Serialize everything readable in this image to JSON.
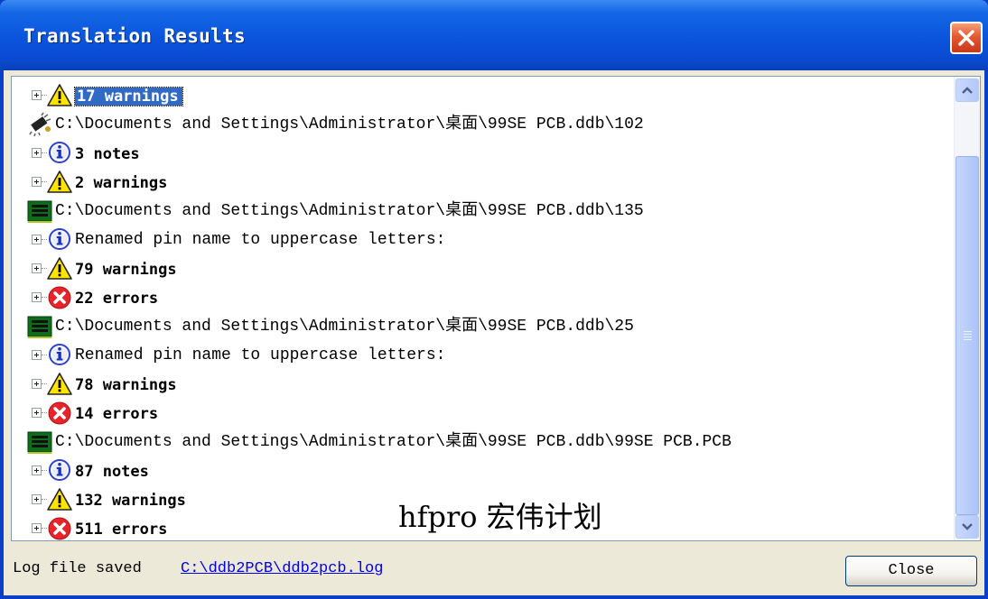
{
  "window": {
    "title": "Translation Results"
  },
  "tree": [
    {
      "kind": "warning",
      "text": "17 warnings",
      "bold": true,
      "selected": true,
      "indent": 1
    },
    {
      "kind": "component",
      "text": "C:\\Documents and Settings\\Administrator\\桌面\\99SE PCB.ddb\\102",
      "indent": 0
    },
    {
      "kind": "note",
      "text": "3 notes",
      "bold": true,
      "indent": 1
    },
    {
      "kind": "warning",
      "text": "2 warnings",
      "bold": true,
      "indent": 1
    },
    {
      "kind": "pcb",
      "text": "C:\\Documents and Settings\\Administrator\\桌面\\99SE PCB.ddb\\135",
      "indent": 0
    },
    {
      "kind": "note",
      "text": "Renamed pin name to uppercase letters:",
      "indent": 1
    },
    {
      "kind": "warning",
      "text": "79 warnings",
      "bold": true,
      "indent": 1
    },
    {
      "kind": "error",
      "text": "22 errors",
      "bold": true,
      "indent": 1
    },
    {
      "kind": "pcb",
      "text": "C:\\Documents and Settings\\Administrator\\桌面\\99SE PCB.ddb\\25",
      "indent": 0
    },
    {
      "kind": "note",
      "text": "Renamed pin name to uppercase letters:",
      "indent": 1
    },
    {
      "kind": "warning",
      "text": "78 warnings",
      "bold": true,
      "indent": 1
    },
    {
      "kind": "error",
      "text": "14 errors",
      "bold": true,
      "indent": 1
    },
    {
      "kind": "pcb",
      "text": "C:\\Documents and Settings\\Administrator\\桌面\\99SE PCB.ddb\\99SE PCB.PCB",
      "indent": 0
    },
    {
      "kind": "note",
      "text": "87 notes",
      "bold": true,
      "indent": 1
    },
    {
      "kind": "warning",
      "text": "132 warnings",
      "bold": true,
      "indent": 1
    },
    {
      "kind": "error",
      "text": "511 errors",
      "bold": true,
      "indent": 1
    }
  ],
  "watermark": "hfpro 宏伟计划",
  "footer": {
    "label": "Log file saved",
    "link": "C:\\ddb2PCB\\ddb2pcb.log",
    "close_label": "Close"
  },
  "colors": {
    "titlebar": "#0a54dc",
    "selection": "#316ac5",
    "link": "#0000ee"
  }
}
